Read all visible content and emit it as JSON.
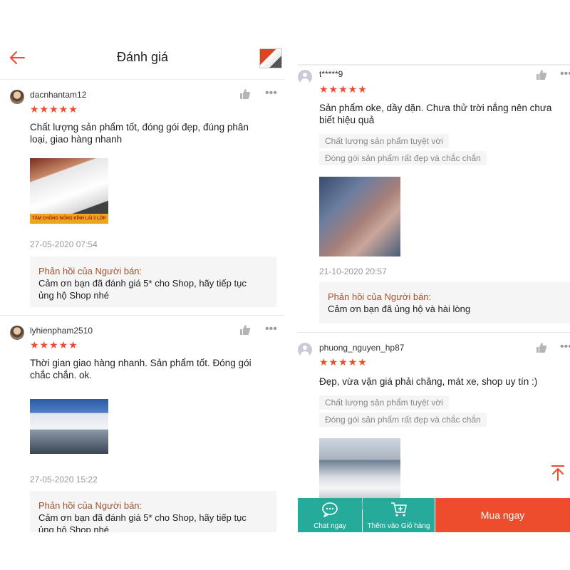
{
  "left": {
    "header": {
      "title": "Đánh giá"
    },
    "reviews": [
      {
        "username": "dacnhantam12",
        "stars": "★★★★★",
        "text_lines": [
          "Chất lượng sản phẩm tốt, đóng gói đẹp, đúng phân",
          "loại, giao hàng nhanh"
        ],
        "image_banner": "TẤM CHỐNG NÓNG KÍNH LÁI 3 LỚP",
        "date": "27-05-2020 07:54",
        "reply_title": "Phản hồi của Người bán:",
        "reply_lines": [
          "Cảm ơn bạn đã đánh giá 5* cho Shop, hãy tiếp tục",
          "ủng hộ Shop nhé"
        ]
      },
      {
        "username": "lyhienpham2510",
        "stars": "★★★★★",
        "text_lines": [
          "Thời gian giao hàng nhanh. Sản phẩm tốt. Đóng gói",
          "chắc chắn. ok."
        ],
        "date": "27-05-2020 15:22",
        "reply_title": "Phản hồi của Người bán:",
        "reply_lines": [
          "Cảm ơn bạn đã đánh giá 5* cho Shop, hãy tiếp tục",
          "ủng hộ Shop nhé"
        ]
      }
    ]
  },
  "right": {
    "reviews": [
      {
        "username": "t*****9",
        "stars": "★★★★★",
        "text_lines": [
          "Sản phẩm oke, dầy dặn. Chưa thử trời nắng nên chưa",
          "biết hiệu quả"
        ],
        "tags": [
          "Chất lượng sản phẩm tuyệt vời",
          "Đóng gói sản phẩm rất đẹp và chắc chắn"
        ],
        "date": "21-10-2020 20:57",
        "reply_title": "Phản hồi của Người bán:",
        "reply_lines": [
          "Cảm ơn bạn đã ủng hộ và hài lòng"
        ]
      },
      {
        "username": "phuong_nguyen_hp87",
        "stars": "★★★★★",
        "text_lines": [
          "Đẹp, vừa vặn giá phải chăng, mát xe, shop uy tín :)"
        ],
        "tags": [
          "Chất lượng sản phẩm tuyệt vời",
          "Đóng gói sản phẩm rất đẹp và chắc chắn"
        ]
      }
    ],
    "bottom_bar": {
      "chat_label": "Chat ngay",
      "cart_label": "Thêm vào Giỏ hàng",
      "buy_label": "Mua ngay"
    }
  },
  "colors": {
    "accent": "#ee4d2d",
    "teal": "#26aa99",
    "reply_title": "#a0522d"
  },
  "icons": [
    "back-arrow-icon",
    "like-icon",
    "more-icon",
    "chat-icon",
    "add-to-cart-icon",
    "scroll-top-icon"
  ]
}
